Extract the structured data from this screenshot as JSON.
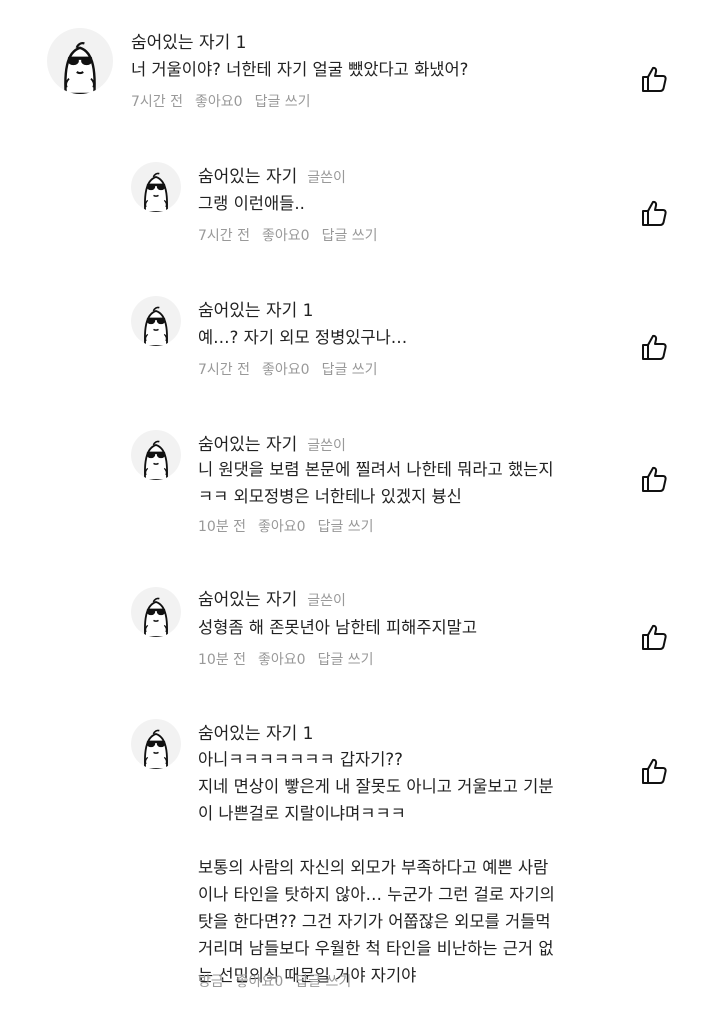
{
  "comments": [
    {
      "author": "숨어있는 자기 1",
      "writer_tag": "",
      "lines": [
        "너 거울이야? 너한테 자기 얼굴 뺐았다고 화냈어?"
      ],
      "time": "7시간 전",
      "likes": "좋아요0",
      "reply": "답글 쓰기"
    },
    {
      "author": "숨어있는 자기",
      "writer_tag": "글쓴이",
      "lines": [
        "그랭 이런애들.."
      ],
      "time": "7시간 전",
      "likes": "좋아요0",
      "reply": "답글 쓰기"
    },
    {
      "author": "숨어있는 자기 1",
      "writer_tag": "",
      "lines": [
        "예…? 자기 외모 정병있구나…"
      ],
      "time": "7시간 전",
      "likes": "좋아요0",
      "reply": "답글 쓰기"
    },
    {
      "author": "숨어있는 자기",
      "writer_tag": "글쓴이",
      "lines": [
        "니 원댓을 보렴 본문에 찔려서 나한테 뭐라고 했는지",
        "ㅋㅋ 외모정병은 너한테나 있겠지 븅신"
      ],
      "time": "10분 전",
      "likes": "좋아요0",
      "reply": "답글 쓰기"
    },
    {
      "author": "숨어있는 자기",
      "writer_tag": "글쓴이",
      "lines": [
        "성형좀 해 존못년아 남한테 피해주지말고"
      ],
      "time": "10분 전",
      "likes": "좋아요0",
      "reply": "답글 쓰기"
    },
    {
      "author": "숨어있는 자기 1",
      "writer_tag": "",
      "lines": [
        "아니ㅋㅋㅋㅋㅋㅋㅋ 갑자기??",
        "지네 면상이 빻은게 내 잘못도 아니고 거울보고 기분",
        "이 나쁜걸로 지랄이냐며ㅋㅋㅋ",
        "",
        "보통의 사람의 자신의 외모가 부족하다고 예쁜 사람",
        "이나 타인을 탓하지 않아… 누군가 그런 걸로 자기의",
        "탓을 한다면?? 그건 자기가 어쭙잖은 외모를 거들먹",
        "거리며 남들보다 우월한 척 타인을 비난하는 근거 없",
        "는 선민의식 때문일 거야 자기야"
      ],
      "time": "방금",
      "likes": "좋아요0",
      "reply": "답글 쓰기"
    }
  ],
  "icons": {
    "avatar": "sunglasses-ghost-avatar-icon",
    "like": "thumbs-up-icon"
  }
}
